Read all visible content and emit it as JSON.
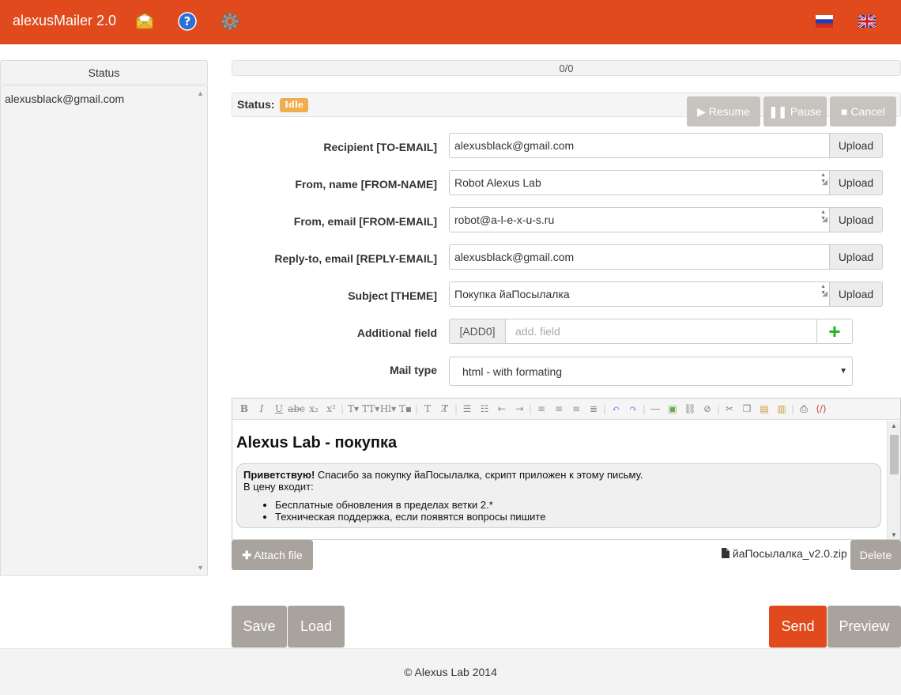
{
  "header": {
    "brand": "alexusMailer 2.0",
    "icons": [
      "envelope-icon",
      "help-icon",
      "settings-icon",
      "flag-ru-icon",
      "flag-uk-icon"
    ]
  },
  "sidebar": {
    "title": "Status",
    "items": [
      "alexusblack@gmail.com"
    ]
  },
  "progress": {
    "text": "0/0"
  },
  "status": {
    "label": "Status:",
    "badge": "Idle",
    "buttons": {
      "resume": "Resume",
      "pause": "Pause",
      "cancel": "Cancel"
    }
  },
  "form": {
    "recipient": {
      "label": "Recipient [TO-EMAIL]",
      "value": "alexusblack@gmail.com"
    },
    "from_name": {
      "label": "From, name [FROM-NAME]",
      "value": "Robot Alexus Lab"
    },
    "from_email": {
      "label": "From, email [FROM-EMAIL]",
      "value": "robot@a-l-e-x-u-s.ru"
    },
    "reply_to": {
      "label": "Reply-to, email [REPLY-EMAIL]",
      "value": "alexusblack@gmail.com"
    },
    "subject": {
      "label": "Subject [THEME]",
      "value": "Покупка йаПосылалка"
    },
    "additional": {
      "label": "Additional field",
      "addon": "[ADD0]",
      "placeholder": "add. field"
    },
    "mail_type": {
      "label": "Mail type",
      "value": "html - with formating"
    },
    "upload_label": "Upload"
  },
  "editor": {
    "heading": "Alexus Lab - покупка",
    "greeting": "Приветствую!",
    "line1": " Спасибо за покупку йаПосылалка, скрипт приложен к этому письму.",
    "line2": "В цену входит:",
    "bullets": [
      "Бесплатные обновления в пределах ветки 2.*",
      "Техническая поддержка, если появятся вопросы пишите"
    ]
  },
  "attachments": {
    "attach_label": "Attach file",
    "file_name": "йаПосылалка_v2.0.zip",
    "delete_label": "Delete"
  },
  "actions": {
    "save": "Save",
    "load": "Load",
    "send": "Send",
    "preview": "Preview"
  },
  "footer": {
    "text": "© Alexus Lab 2014"
  },
  "colors": {
    "brand": "#e04a1c",
    "badge": "#f0ad4e",
    "gray_button": "#a9a39e",
    "add_green": "#22b022"
  }
}
